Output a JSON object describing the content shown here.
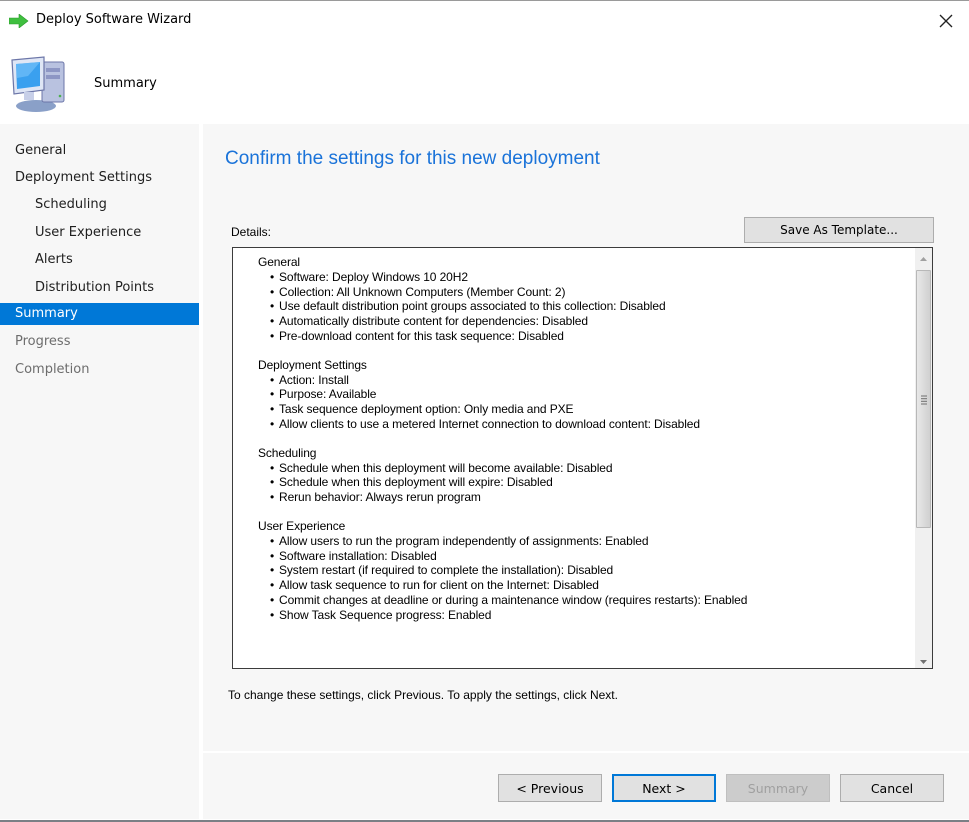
{
  "window": {
    "title": "Deploy Software Wizard",
    "close_label": "Close"
  },
  "header": {
    "title": "Summary",
    "icon": "computer-icon"
  },
  "sidebar": {
    "items": [
      {
        "label": "General",
        "state": "completed",
        "level": 0
      },
      {
        "label": "Deployment Settings",
        "state": "completed",
        "level": 0
      },
      {
        "label": "Scheduling",
        "state": "completed",
        "level": 1
      },
      {
        "label": "User Experience",
        "state": "completed",
        "level": 1
      },
      {
        "label": "Alerts",
        "state": "completed",
        "level": 1
      },
      {
        "label": "Distribution Points",
        "state": "completed",
        "level": 1
      },
      {
        "label": "Summary",
        "state": "active",
        "level": 0
      },
      {
        "label": "Progress",
        "state": "disabled",
        "level": 0
      },
      {
        "label": "Completion",
        "state": "disabled",
        "level": 0
      }
    ]
  },
  "main": {
    "heading": "Confirm the settings for this new deployment",
    "details_label": "Details:",
    "save_template_label": "Save As Template...",
    "details": [
      {
        "title": "General",
        "items": [
          "Software: Deploy Windows 10 20H2",
          "Collection: All Unknown Computers (Member Count: 2)",
          "Use default distribution point groups associated to this collection: Disabled",
          "Automatically distribute content for dependencies: Disabled",
          "Pre-download content for this task sequence: Disabled"
        ]
      },
      {
        "title": "Deployment Settings",
        "items": [
          "Action: Install",
          "Purpose: Available",
          "Task sequence deployment option: Only media and PXE",
          "Allow clients to use a metered Internet connection to download content: Disabled"
        ]
      },
      {
        "title": "Scheduling",
        "items": [
          "Schedule when this deployment will become available: Disabled",
          "Schedule when this deployment will expire: Disabled",
          "Rerun behavior: Always rerun program"
        ]
      },
      {
        "title": "User Experience",
        "items": [
          "Allow users to run the program independently of assignments: Enabled",
          "Software installation: Disabled",
          "System restart (if required to complete the installation): Disabled",
          "Allow task sequence to run for client on the Internet: Disabled",
          "Commit changes at deadline or during a maintenance window (requires restarts): Enabled",
          "Show Task Sequence progress: Enabled"
        ]
      }
    ],
    "bullet": "•",
    "hint": "To change these settings, click Previous. To apply the settings, click Next."
  },
  "footer": {
    "previous_label": "< Previous",
    "next_label": "Next >",
    "summary_label": "Summary",
    "cancel_label": "Cancel"
  },
  "colors": {
    "accent": "#0078d7",
    "heading": "#1a73d9",
    "panel_bg": "#f7f7f7"
  }
}
